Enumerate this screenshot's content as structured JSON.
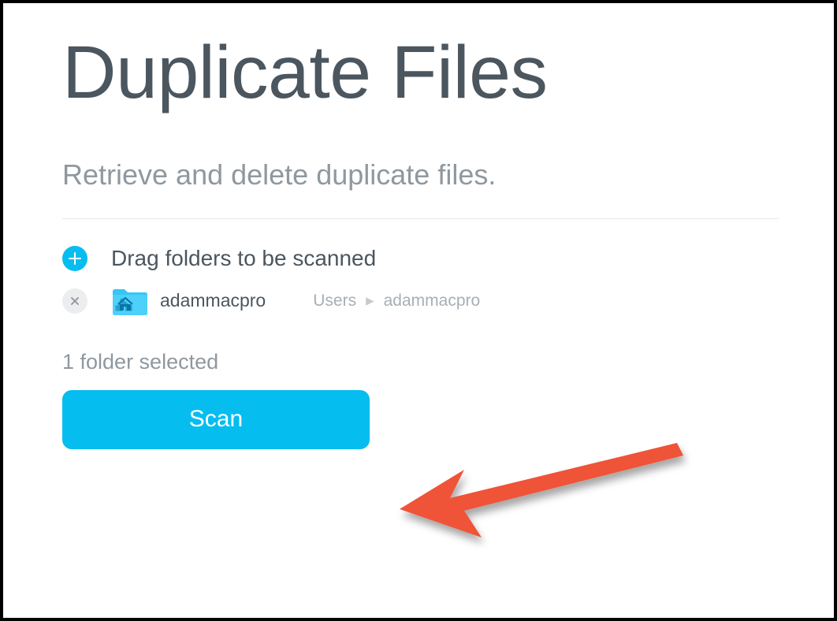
{
  "page": {
    "title": "Duplicate Files",
    "subtitle": "Retrieve and delete duplicate files."
  },
  "dropzone": {
    "drag_label": "Drag folders to be scanned",
    "items": [
      {
        "name": "adammacpro",
        "breadcrumb": [
          "Users",
          "adammacpro"
        ]
      }
    ]
  },
  "status": {
    "text": "1 folder selected"
  },
  "actions": {
    "scan_label": "Scan"
  },
  "colors": {
    "accent": "#06bdf0",
    "annotation_arrow": "#ef5338"
  }
}
